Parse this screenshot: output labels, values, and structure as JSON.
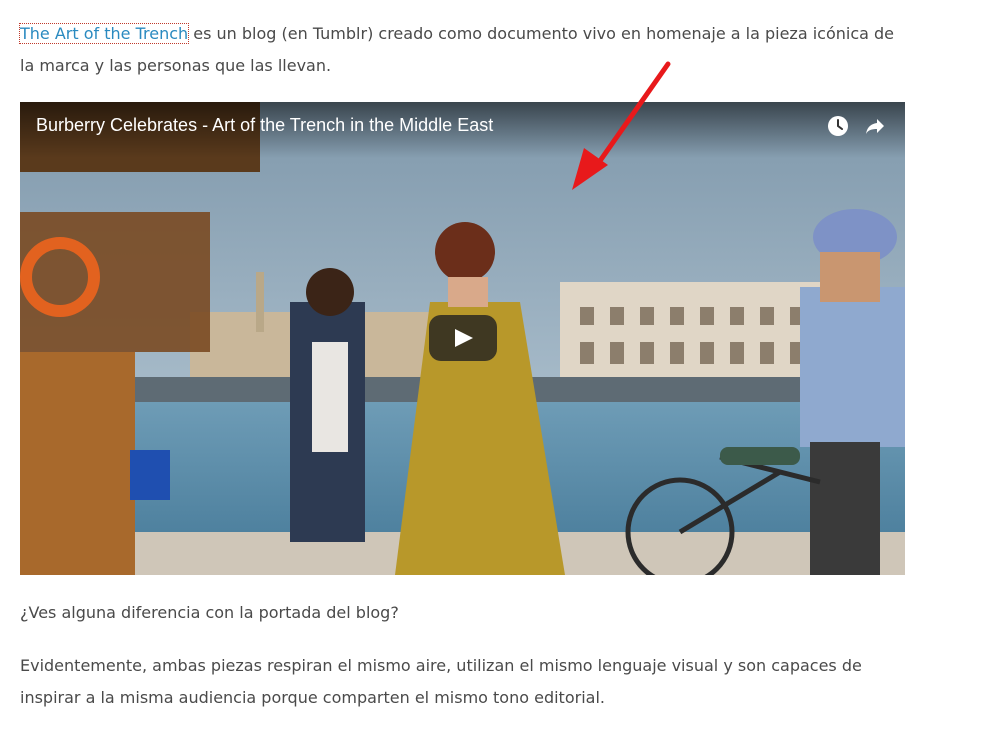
{
  "intro": {
    "link_text": "The Art of the Trench",
    "text": " es un blog (en Tumblr) creado como documento vivo en homenaje a la pieza icónica de la marca y las personas que las llevan."
  },
  "video": {
    "title": "Burberry Celebrates - Art of the Trench in the Middle East",
    "icons": {
      "watch_later": "clock-icon",
      "share": "share-icon",
      "play": "play-icon"
    }
  },
  "paragraphs": [
    "¿Ves alguna diferencia con la portada del blog?",
    "Evidentemente, ambas piezas respiran el mismo aire, utilizan el mismo lenguaje visual y son capaces de inspirar a la misma audiencia porque comparten el mismo tono editorial."
  ],
  "colors": {
    "link": "#2a8ac0",
    "text": "#4a4a4a",
    "annotation_arrow": "#e8191b"
  }
}
